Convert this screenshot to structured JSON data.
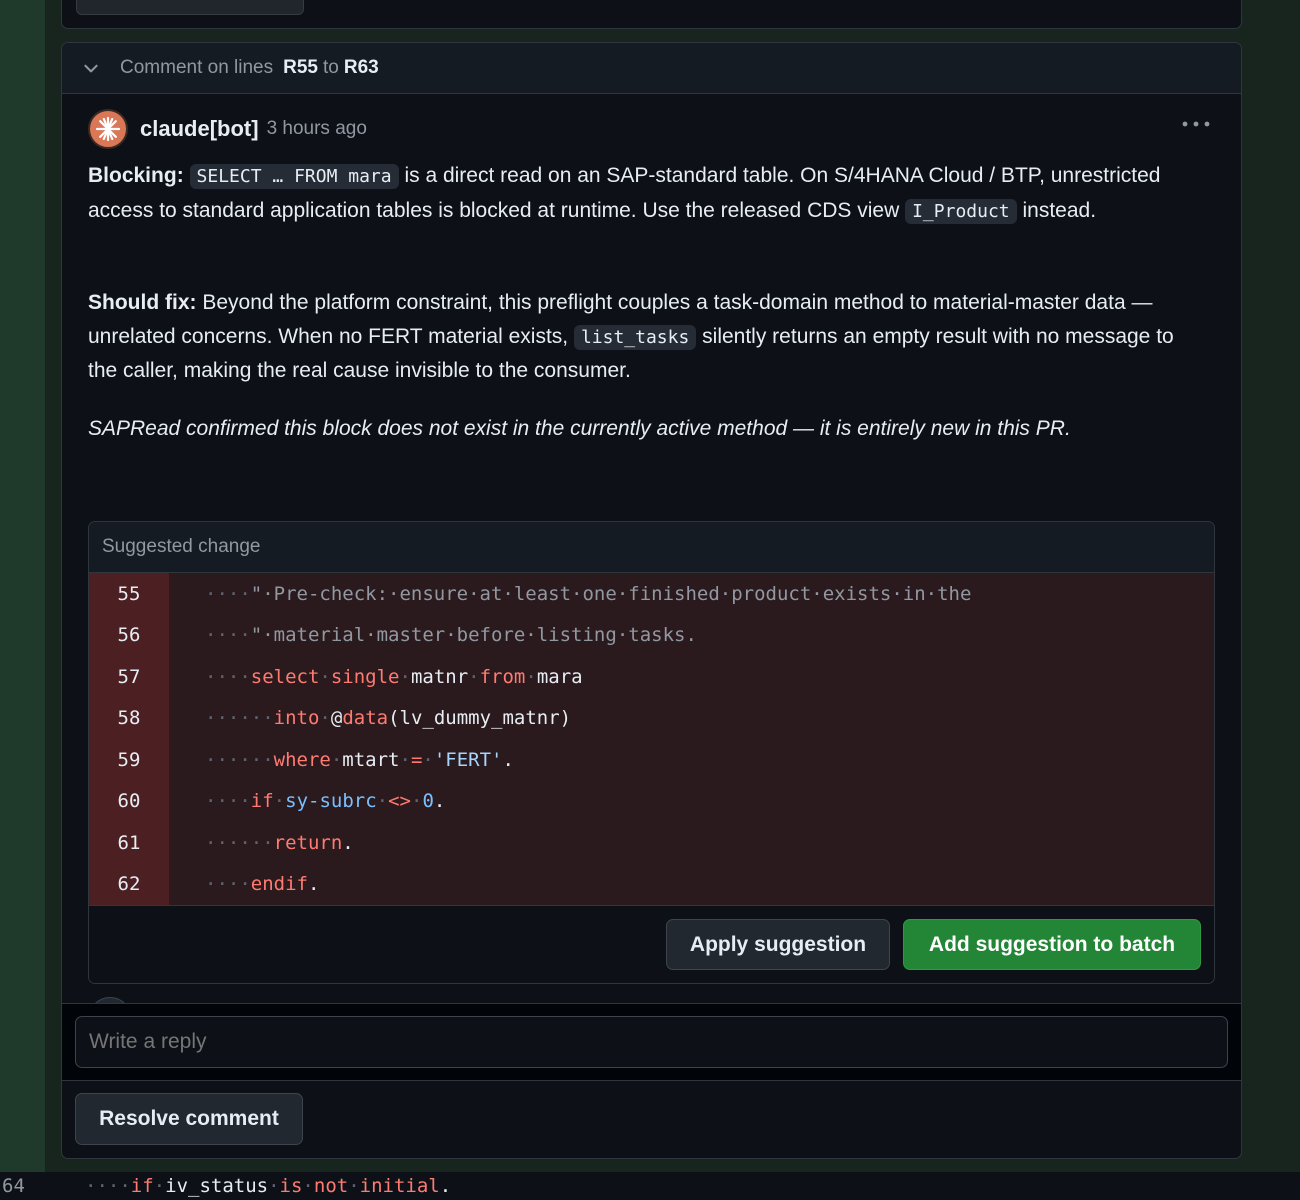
{
  "thread": {
    "header_prefix": "Comment on lines",
    "line_start": "R55",
    "header_to": "to",
    "line_end": "R63"
  },
  "comment": {
    "author": "claude[bot]",
    "timestamp": "3 hours ago",
    "p1": {
      "label": "Blocking",
      "code1": "SELECT … FROM mara",
      "text1": " is a direct read on an SAP-standard table. On S/4HANA Cloud / BTP, unrestricted access to standard application tables is blocked at runtime. Use the released CDS view ",
      "code2": "I_Product",
      "text2": " instead."
    },
    "p2": {
      "label": "Should fix",
      "text1": " Beyond the platform constraint, this preflight couples a task-domain method to material-master data — unrelated concerns. When no FERT material exists, ",
      "code1": "list_tasks",
      "text2": " silently returns an empty result with no message to the caller, making the real cause invisible to the consumer."
    },
    "p3": "SAPRead confirmed this block does not exist in the currently active method — it is entirely new in this PR."
  },
  "suggestion": {
    "title": "Suggested change",
    "lines": [
      {
        "num": "55",
        "tokens": [
          [
            "ws",
            "····"
          ],
          [
            "cm",
            "\"·Pre-check:·ensure·at·least·one·finished·product·exists·in·the"
          ]
        ]
      },
      {
        "num": "56",
        "tokens": [
          [
            "ws",
            "····"
          ],
          [
            "cm",
            "\"·material·master·before·listing·tasks."
          ]
        ]
      },
      {
        "num": "57",
        "tokens": [
          [
            "ws",
            "····"
          ],
          [
            "kw",
            "select"
          ],
          [
            "ws",
            "·"
          ],
          [
            "kw",
            "single"
          ],
          [
            "ws",
            "·"
          ],
          [
            "tx",
            "matnr"
          ],
          [
            "ws",
            "·"
          ],
          [
            "kw",
            "from"
          ],
          [
            "ws",
            "·"
          ],
          [
            "tx",
            "mara"
          ]
        ]
      },
      {
        "num": "58",
        "tokens": [
          [
            "ws",
            "······"
          ],
          [
            "kw",
            "into"
          ],
          [
            "ws",
            "·"
          ],
          [
            "tx",
            "@"
          ],
          [
            "kw",
            "data"
          ],
          [
            "tx",
            "(lv_dummy_matnr)"
          ]
        ]
      },
      {
        "num": "59",
        "tokens": [
          [
            "ws",
            "······"
          ],
          [
            "kw",
            "where"
          ],
          [
            "ws",
            "·"
          ],
          [
            "tx",
            "mtart"
          ],
          [
            "ws",
            "·"
          ],
          [
            "kw",
            "="
          ],
          [
            "ws",
            "·"
          ],
          [
            "st",
            "'FERT'"
          ],
          [
            "tx",
            "."
          ]
        ]
      },
      {
        "num": "60",
        "tokens": [
          [
            "ws",
            "···"
          ],
          [
            "ws",
            "·"
          ],
          [
            "kw",
            "if"
          ],
          [
            "ws",
            "·"
          ],
          [
            "fn",
            "sy-subrc"
          ],
          [
            "ws",
            "·"
          ],
          [
            "kw",
            "<>"
          ],
          [
            "ws",
            "·"
          ],
          [
            "fn",
            "0"
          ],
          [
            "tx",
            "."
          ]
        ]
      },
      {
        "num": "61",
        "tokens": [
          [
            "ws",
            "······"
          ],
          [
            "kw",
            "return"
          ],
          [
            "tx",
            "."
          ]
        ]
      },
      {
        "num": "62",
        "tokens": [
          [
            "ws",
            "···"
          ],
          [
            "ws",
            "·"
          ],
          [
            "kw",
            "endif"
          ],
          [
            "tx",
            "."
          ]
        ]
      }
    ],
    "apply_label": "Apply suggestion",
    "batch_label": "Add suggestion to batch"
  },
  "reply": {
    "placeholder": "Write a reply"
  },
  "resolve_label": "Resolve comment",
  "bottom_line": {
    "num": "64",
    "tokens": [
      [
        "ws",
        "···"
      ],
      [
        "ws",
        "·"
      ],
      [
        "kw",
        "if"
      ],
      [
        "ws",
        "·"
      ],
      [
        "tx",
        "iv_status"
      ],
      [
        "ws",
        "·"
      ],
      [
        "kw",
        "is"
      ],
      [
        "ws",
        "·"
      ],
      [
        "kw",
        "not"
      ],
      [
        "ws",
        "·"
      ],
      [
        "kw",
        "initial"
      ],
      [
        "tx",
        "."
      ]
    ]
  },
  "colors": {
    "accent_green": "#238636",
    "deleted_line_bg": "#2b1a1d",
    "deleted_gutter_bg": "#4c1f22",
    "keyword": "#ff7b72",
    "constant": "#79c0ff",
    "avatar": "#d97757"
  },
  "icons": [
    "chevron-down-icon",
    "claude-logo-icon",
    "kebab-menu-icon",
    "smiley-icon"
  ]
}
